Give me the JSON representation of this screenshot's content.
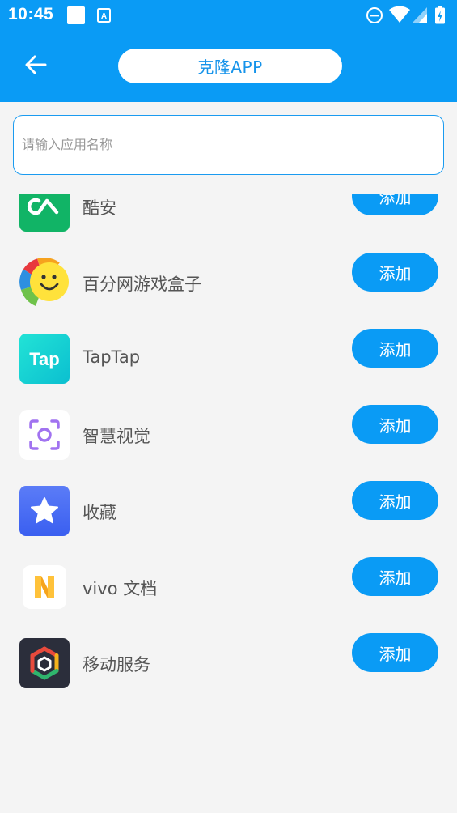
{
  "status_bar": {
    "time": "10:45",
    "icons": [
      "notification-square-icon",
      "a-keyboard-icon",
      "do-not-disturb-icon",
      "wifi-icon",
      "signal-icon",
      "battery-icon"
    ]
  },
  "header": {
    "title": "克隆APP",
    "back_icon": "arrow-left-icon",
    "background_color": "#0a9bf5"
  },
  "search": {
    "value": "",
    "placeholder": "请输入应用名称"
  },
  "apps": [
    {
      "name": "酷安",
      "icon": "coolapk-icon",
      "action": "添加"
    },
    {
      "name": "百分网游戏盒子",
      "icon": "smiley-game-box-icon",
      "action": "添加"
    },
    {
      "name": "TapTap",
      "icon": "taptap-icon",
      "action": "添加"
    },
    {
      "name": "智慧视觉",
      "icon": "smart-vision-icon",
      "action": "添加"
    },
    {
      "name": "收藏",
      "icon": "star-favorites-icon",
      "action": "添加"
    },
    {
      "name": "vivo 文档",
      "icon": "vivo-docs-icon",
      "action": "添加"
    },
    {
      "name": "移动服务",
      "icon": "mobile-services-icon",
      "action": "添加"
    }
  ],
  "colors": {
    "accent": "#0a9bf5",
    "page_background": "#f4f4f4"
  }
}
